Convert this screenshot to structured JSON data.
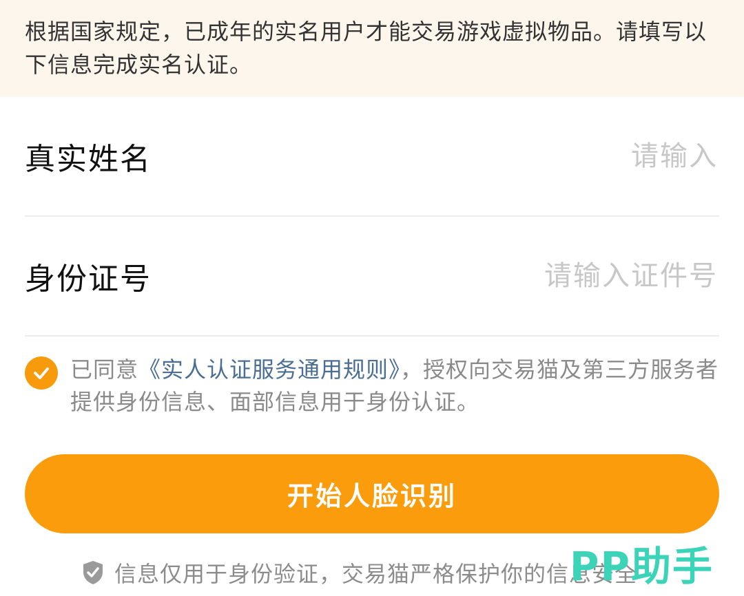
{
  "notice": {
    "text": "根据国家规定，已成年的实名用户才能交易游戏虚拟物品。请填写以下信息完成实名认证。"
  },
  "form": {
    "name_label": "真实姓名",
    "name_placeholder": "请输入",
    "name_value": "",
    "id_label": "身份证号",
    "id_placeholder": "请输入证件号",
    "id_value": ""
  },
  "agreement": {
    "checked": true,
    "prefix": "已同意",
    "link_text": "《实人认证服务通用规则》",
    "suffix": "，授权向交易猫及第三方服务者提供身份信息、面部信息用于身份认证。"
  },
  "cta": {
    "label": "开始人脸识别"
  },
  "security_note": {
    "icon": "shield-check-icon",
    "text": "信息仅用于身份验证，交易猫严格保护你的信息安全"
  },
  "watermark": {
    "text": "PP助手"
  },
  "colors": {
    "accent": "#fa9c0b",
    "notice_bg": "#fdf6ec",
    "link": "#4a6d94",
    "watermark": "#3cd4b8"
  }
}
